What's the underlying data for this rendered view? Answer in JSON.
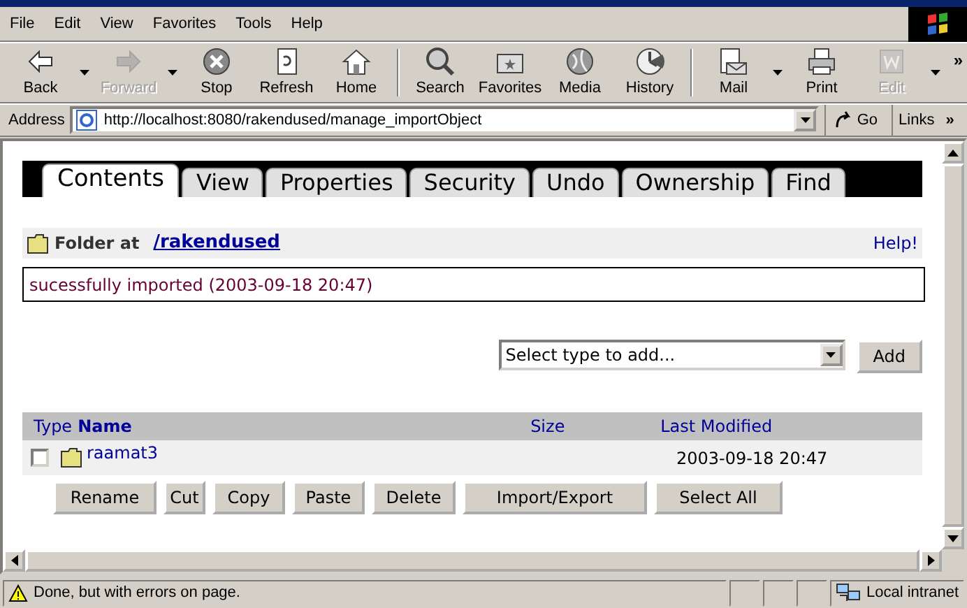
{
  "menu": [
    "File",
    "Edit",
    "View",
    "Favorites",
    "Tools",
    "Help"
  ],
  "toolbar": [
    {
      "kind": "button",
      "label": "Back",
      "disabled": false,
      "dropdown": true
    },
    {
      "kind": "button",
      "label": "Forward",
      "disabled": true,
      "dropdown": true
    },
    {
      "kind": "button",
      "label": "Stop",
      "disabled": false,
      "dropdown": false
    },
    {
      "kind": "button",
      "label": "Refresh",
      "disabled": false,
      "dropdown": false
    },
    {
      "kind": "button",
      "label": "Home",
      "disabled": false,
      "dropdown": false
    },
    {
      "kind": "separator"
    },
    {
      "kind": "button",
      "label": "Search",
      "disabled": false,
      "dropdown": false
    },
    {
      "kind": "button",
      "label": "Favorites",
      "disabled": false,
      "dropdown": false
    },
    {
      "kind": "button",
      "label": "Media",
      "disabled": false,
      "dropdown": false
    },
    {
      "kind": "button",
      "label": "History",
      "disabled": false,
      "dropdown": false
    },
    {
      "kind": "separator"
    },
    {
      "kind": "button",
      "label": "Mail",
      "disabled": false,
      "dropdown": true
    },
    {
      "kind": "button",
      "label": "Print",
      "disabled": false,
      "dropdown": false
    },
    {
      "kind": "button",
      "label": "Edit",
      "disabled": true,
      "dropdown": true
    }
  ],
  "toolbar_more": "»",
  "address": {
    "label": "Address",
    "url": "http://localhost:8080/rakendused/manage_importObject",
    "go": "Go",
    "links": "Links",
    "links_more": "»"
  },
  "tabs": [
    {
      "label": "Contents",
      "selected": true
    },
    {
      "label": "View",
      "selected": false
    },
    {
      "label": "Properties",
      "selected": false
    },
    {
      "label": "Security",
      "selected": false
    },
    {
      "label": "Undo",
      "selected": false
    },
    {
      "label": "Ownership",
      "selected": false
    },
    {
      "label": "Find",
      "selected": false
    }
  ],
  "folder": {
    "label": "Folder at",
    "path": "/rakendused",
    "help": "Help!"
  },
  "message": "sucessfully imported (2003-09-18 20:47)",
  "add": {
    "placeholder": "Select type to add...",
    "button": "Add"
  },
  "table": {
    "columns": [
      {
        "label": "Type",
        "sorted": false
      },
      {
        "label": "Name",
        "sorted": true
      },
      {
        "label": "Size",
        "sorted": false
      },
      {
        "label": "Last Modified",
        "sorted": false
      }
    ],
    "rows": [
      {
        "name": "raamat3",
        "modified": "2003-09-18 20:47",
        "checked": false
      }
    ]
  },
  "actions": [
    "Rename",
    "Cut",
    "Copy",
    "Paste",
    "Delete",
    "Import/Export",
    "Select All"
  ],
  "status": {
    "text": "Done, but with errors on page.",
    "zone": "Local intranet"
  }
}
